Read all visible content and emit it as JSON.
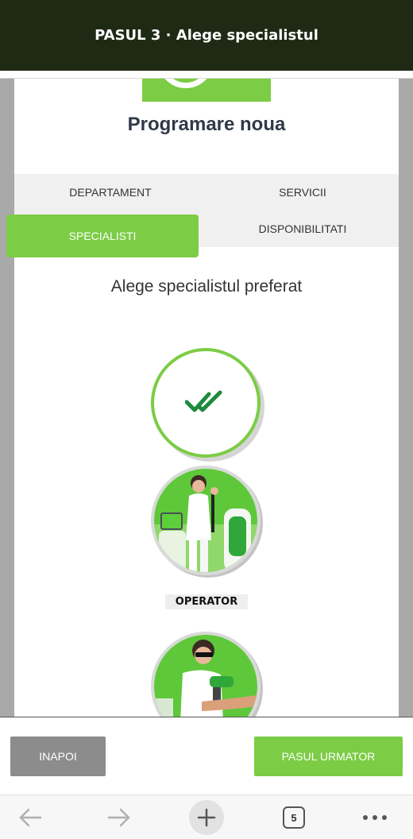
{
  "header": {
    "title": "PASUL 3 · Alege specialistul"
  },
  "page": {
    "title": "Programare noua",
    "subtitle": "Alege specialistul preferat"
  },
  "tabs": [
    {
      "label": "DEPARTAMENT",
      "active": false
    },
    {
      "label": "SERVICII",
      "active": false
    },
    {
      "label": "SPECIALISTI",
      "active": true
    },
    {
      "label": "DISPONIBILITATI",
      "active": false
    }
  ],
  "specialists": [
    {
      "label": "OPERATOR"
    }
  ],
  "actions": {
    "back_label": "INAPOI",
    "next_label": "PASUL URMATOR"
  },
  "browser": {
    "tab_count": "5"
  },
  "colors": {
    "accent": "#7ccc45",
    "header_bg": "#1f2a15",
    "check": "#1e8a3c",
    "back_button": "#8c8c8c"
  }
}
